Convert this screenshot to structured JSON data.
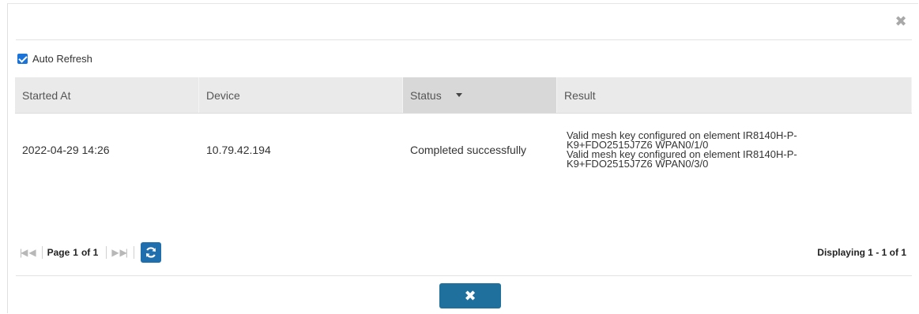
{
  "dialog": {
    "auto_refresh": {
      "label": "Auto Refresh",
      "checked": true
    }
  },
  "table": {
    "columns": [
      "Started At",
      "Device",
      "Status",
      "Result"
    ],
    "sorted_column": "Status",
    "rows": [
      {
        "started_at": "2022-04-29 14:26",
        "device": "10.79.42.194",
        "status": "Completed successfully",
        "result_lines": [
          "Valid mesh key configured on element IR8140H-P-",
          "K9+FDO2515J7Z6 WPAN0/1/0",
          "Valid mesh key configured on element IR8140H-P-",
          "K9+FDO2515J7Z6 WPAN0/3/0"
        ]
      }
    ]
  },
  "pager": {
    "page_label": "Page",
    "page_value": "1",
    "of_label": "of 1",
    "displaying": "Displaying 1 - 1 of 1"
  },
  "icons": {
    "close": "close-icon",
    "first": "first-page-icon",
    "prev": "prev-page-icon",
    "next": "next-page-icon",
    "last": "last-page-icon",
    "refresh": "refresh-icon"
  },
  "colors": {
    "accent": "#1f6fae",
    "checkbox": "#1a73d9",
    "header_bg": "#eaeaea"
  }
}
